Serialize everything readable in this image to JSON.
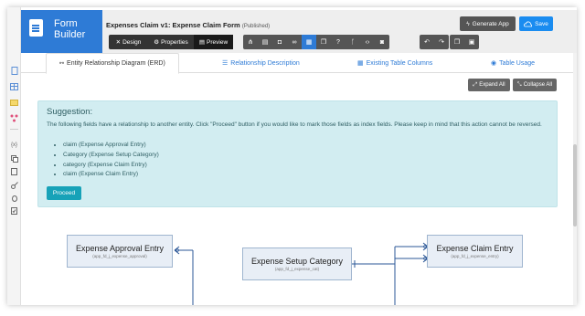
{
  "edit_icon": "edit-pencil-icon",
  "brand": {
    "line1": "Form",
    "line2": "Builder",
    "icon": "document-icon"
  },
  "header": {
    "title": "Expenses Claim v1: Expense Claim Form",
    "status": "(Published)",
    "generate_label": "Generate App",
    "save_label": "Save"
  },
  "modes": [
    {
      "label": "Design",
      "icon": "tools-icon"
    },
    {
      "label": "Properties",
      "icon": "gear-icon"
    },
    {
      "label": "Preview",
      "icon": "preview-icon"
    }
  ],
  "tools": [
    "hierarchy-icon",
    "report-icon",
    "lock-icon",
    "glasses-icon",
    "grid-icon",
    "copy-icon",
    "help-icon",
    "branch-icon",
    "code-icon",
    "camera-icon"
  ],
  "history_tools": [
    "undo-icon",
    "redo-icon"
  ],
  "clipboard_tools": [
    "copy-icon",
    "paste-icon"
  ],
  "sidebar_icons": [
    "document-icon",
    "table-icon",
    "folder-icon",
    "diagram-icon",
    "separator",
    "variable-icon",
    "stack-icon",
    "file-icon",
    "key-icon",
    "bug-icon",
    "file-check-icon"
  ],
  "tabs": [
    {
      "label": "Entity Relationship Diagram (ERD)",
      "icon": "erd-icon"
    },
    {
      "label": "Relationship Description",
      "icon": "list-icon"
    },
    {
      "label": "Existing Table Columns",
      "icon": "table-icon"
    },
    {
      "label": "Table Usage",
      "icon": "eye-icon"
    }
  ],
  "actions": {
    "expand": "Expand All",
    "collapse": "Collapse All"
  },
  "suggestion": {
    "title": "Suggestion:",
    "text": "The following fields have a relationship to another entity. Click \"Proceed\" button if you would like to mark those fields as index fields. Please keep in mind that this action cannot be reversed.",
    "items": [
      "claim (Expense Approval Entry)",
      "Category (Expense Setup Category)",
      "category (Expense Claim Entry)",
      "claim (Expense Claim Entry)"
    ],
    "proceed_label": "Proceed"
  },
  "entities": [
    {
      "name": "Expense Approval Entry",
      "table": "(app_fd_j_expense_approval)"
    },
    {
      "name": "Expense Setup Category",
      "table": "(app_fd_j_expense_cat)"
    },
    {
      "name": "Expense Claim Entry",
      "table": "(app_fd_j_expense_entry)"
    }
  ],
  "colors": {
    "brand": "#2e7bd6",
    "save": "#1a8cf0",
    "suggestion_bg": "#d2edf1",
    "proceed": "#17a2b8",
    "connector": "#2b5797"
  }
}
